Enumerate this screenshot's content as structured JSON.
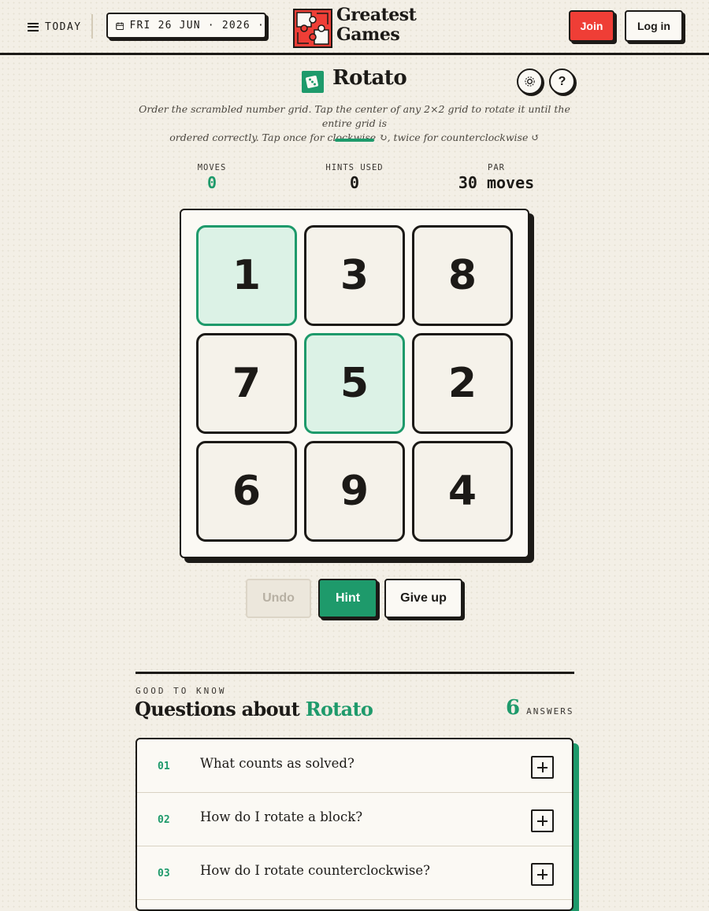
{
  "header": {
    "menu_label": "TODAY",
    "date": "FRI 26 JUN · 2026 ·",
    "logo_line1": "Greatest",
    "logo_line2": "Games",
    "join_label": "Join",
    "login_label": "Log in"
  },
  "game": {
    "title": "Rotato",
    "instructions_line1": "Order the scrambled number grid. Tap the center of any 2×2 grid to rotate it until the entire grid is",
    "instructions_line2": "ordered correctly. Tap once for clockwise ↻, twice for counterclockwise ↺",
    "help_label": "?"
  },
  "stats": {
    "moves_label": "MOVES",
    "moves_value": "0",
    "hints_label": "HINTS USED",
    "hints_value": "0",
    "par_label": "PAR",
    "par_value": "30 moves"
  },
  "board": {
    "tiles": [
      "1",
      "3",
      "8",
      "7",
      "5",
      "2",
      "6",
      "9",
      "4"
    ],
    "correct_positions": [
      0,
      4
    ]
  },
  "actions": {
    "undo": "Undo",
    "hint": "Hint",
    "give_up": "Give up"
  },
  "faq": {
    "kicker": "GOOD TO KNOW",
    "heading_prefix": "Questions about",
    "heading_accent": "Rotato",
    "count": "6",
    "count_label": "ANSWERS",
    "items": [
      {
        "num": "01",
        "question": "What counts as solved?"
      },
      {
        "num": "02",
        "question": "How do I rotate a block?"
      },
      {
        "num": "03",
        "question": "How do I rotate counterclockwise?"
      }
    ]
  },
  "colors": {
    "accent_green": "#1e9a6b",
    "join_red": "#ef3e36",
    "correct_tile_bg": "#dcf2e6",
    "background": "#f3efe6"
  }
}
